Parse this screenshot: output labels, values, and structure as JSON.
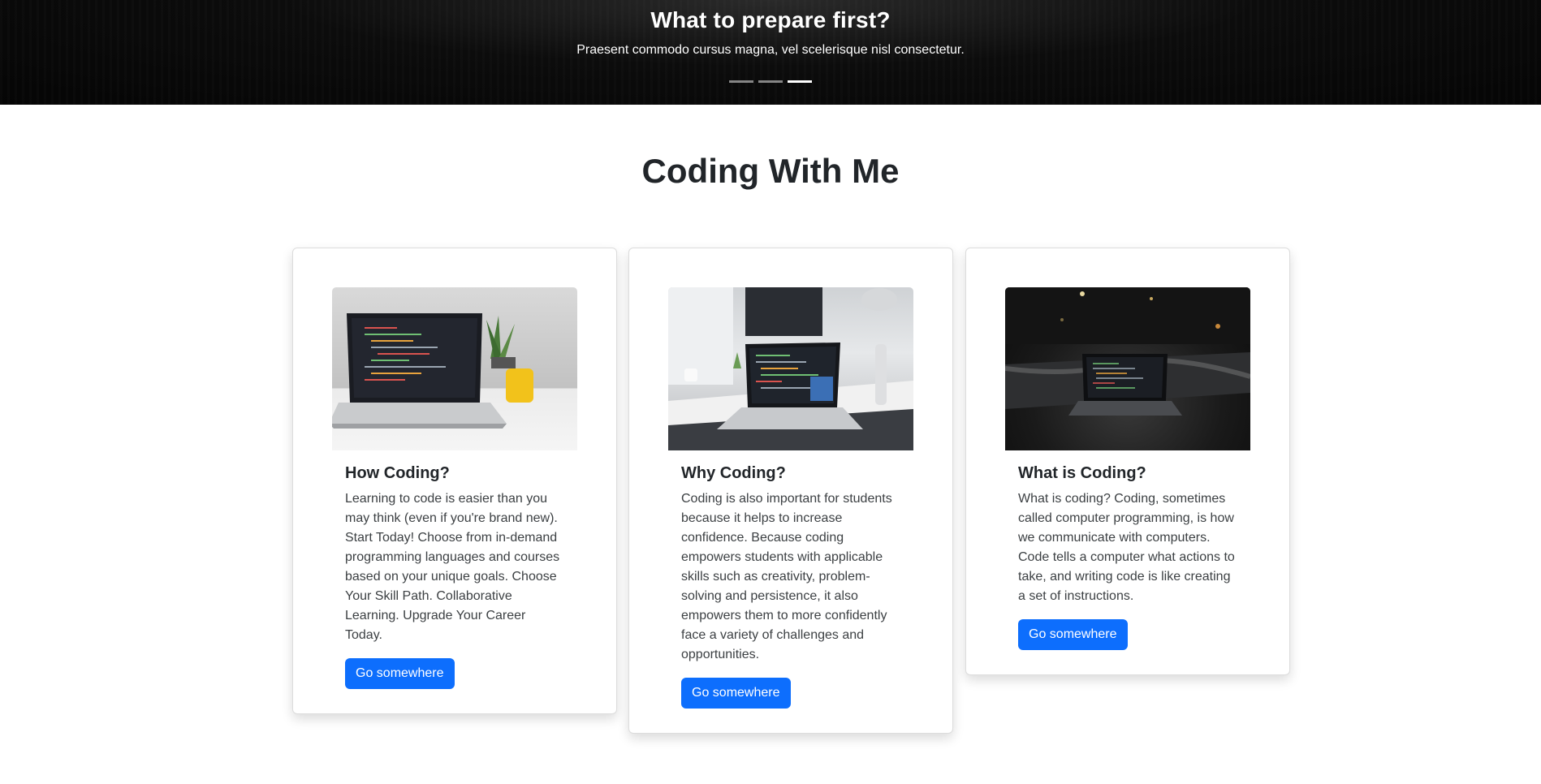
{
  "hero": {
    "title": "What to prepare first?",
    "subtitle": "Praesent commodo cursus magna, vel scelerisque nisl consectetur.",
    "slide_count": 3,
    "active_slide": 3
  },
  "section": {
    "title": "Coding With Me"
  },
  "cards": [
    {
      "image": "laptop-code-bright-desk",
      "title": "How Coding?",
      "text": "Learning to code is easier than you may think (even if you're brand new). Start Today! Choose from in-demand programming languages and courses based on your unique goals. Choose Your Skill Path. Collaborative Learning. Upgrade Your Career Today.",
      "button": "Go somewhere"
    },
    {
      "image": "laptop-code-office-desk",
      "title": "Why Coding?",
      "text": "Coding is also important for students because it helps to increase confidence. Because coding empowers students with applicable skills such as creativity, problem-solving and persistence, it also empowers them to more confidently face a variety of challenges and opportunities.",
      "button": "Go somewhere"
    },
    {
      "image": "laptop-code-dark-street",
      "title": "What is Coding?",
      "text": "What is coding? Coding, sometimes called computer programming, is how we communicate with computers. Code tells a computer what actions to take, and writing code is like creating a set of instructions.",
      "button": "Go somewhere"
    }
  ],
  "colors": {
    "primary_button": "#0d6efd",
    "heading": "#212529",
    "hero_background": "#050505"
  }
}
